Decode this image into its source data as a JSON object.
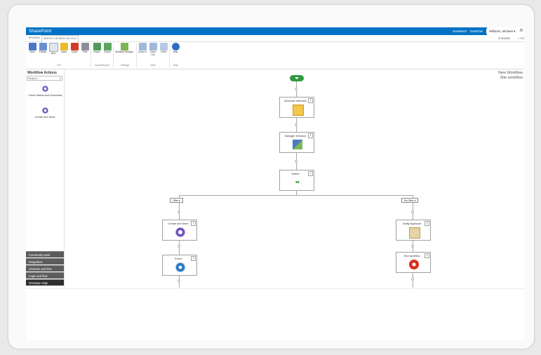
{
  "suite": {
    "brand": "SharePoint",
    "links": [
      "Newsfeed",
      "OneDrive",
      "Sites"
    ],
    "active_link": "Sites",
    "user": "Williams, Michael",
    "settings_icon": "gear-icon"
  },
  "tabs": {
    "browse": "BROWSE",
    "workflow": "WHITELY WORKFLOW 2013",
    "share": "SHARE",
    "follow": "FO"
  },
  "ribbon": {
    "buttons": [
      {
        "label": "Save",
        "icon": "save-icon"
      },
      {
        "label": "Publish",
        "icon": "publish-icon"
      },
      {
        "label": "New",
        "icon": "new-icon"
      },
      {
        "label": "Open",
        "icon": "open-icon"
      },
      {
        "label": "Close",
        "icon": "close-icon"
      },
      {
        "label": "Print",
        "icon": "print-icon"
      },
      {
        "label": "Import",
        "icon": "import-icon"
      },
      {
        "label": "Export",
        "icon": "export-icon"
      },
      {
        "label": "Workflow Settings",
        "icon": "workflow-settings-icon"
      },
      {
        "label": "Zoom In",
        "icon": "zoom-in-icon"
      },
      {
        "label": "Zoom Out",
        "icon": "zoom-out-icon"
      },
      {
        "label": "100%",
        "icon": "zoom-100-icon"
      },
      {
        "label": "Help",
        "icon": "help-icon"
      }
    ],
    "groups": [
      "File",
      "Import/Export",
      "Settings",
      "View",
      "Help"
    ]
  },
  "left": {
    "title": "Workflow Actions",
    "search_placeholder": "Search...",
    "items": [
      "Check Status and Download",
      "Create and Send"
    ],
    "categories": [
      "Commonly used",
      "Integration",
      "Libraries and lists",
      "Logic and flow",
      "OneSpan Sign"
    ]
  },
  "canvas": {
    "workflow_name": "New Workflow",
    "workflow_sub": "Site workflow",
    "nodes": {
      "schedule": "Schedule Interview",
      "manager": "Manager Decision",
      "switch": "Switch",
      "create_send": "Create and Send",
      "notify": "Notify Applicant",
      "event": "Event",
      "end": "End workflow"
    },
    "conditions": {
      "offer": "Offer",
      "no_offer": "No Offer"
    }
  },
  "colors": {
    "suitebar": "#0072c6",
    "start": "#2f9a3f",
    "onespan": "#6b4fbb",
    "end": "#d9301c"
  }
}
